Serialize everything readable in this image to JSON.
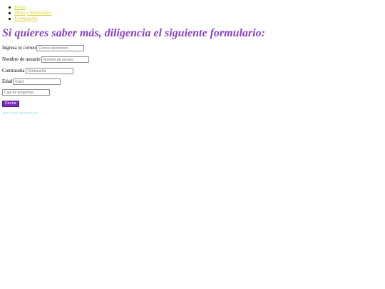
{
  "nav": {
    "items": [
      {
        "label": "Inicio"
      },
      {
        "label": "Tipos y Materiales"
      },
      {
        "label": "Formulario"
      }
    ]
  },
  "page": {
    "title": "Si quieres saber más, diligencia el siguiente formulario:"
  },
  "form": {
    "email": {
      "label": "Ingresa tu correo",
      "placeholder": "Correo electrónico",
      "value": ""
    },
    "username": {
      "label": "Nombre de usuario",
      "placeholder": "Nombre de usuario",
      "value": ""
    },
    "password": {
      "label": "Contraseña",
      "placeholder": "Contraseña",
      "value": ""
    },
    "age": {
      "label": "Edad",
      "placeholder": "Edad",
      "value": ""
    },
    "questions": {
      "placeholder": "Caja de preguntas",
      "value": ""
    },
    "submit_label": "Enviar"
  },
  "footer": {
    "text": "SITIO WEB CREATIVO 2021"
  },
  "colors": {
    "nav_link": "#d8cf2e",
    "title": "#8a3fc8",
    "button": "#7b2fbe",
    "footer": "#7fd6e0"
  }
}
